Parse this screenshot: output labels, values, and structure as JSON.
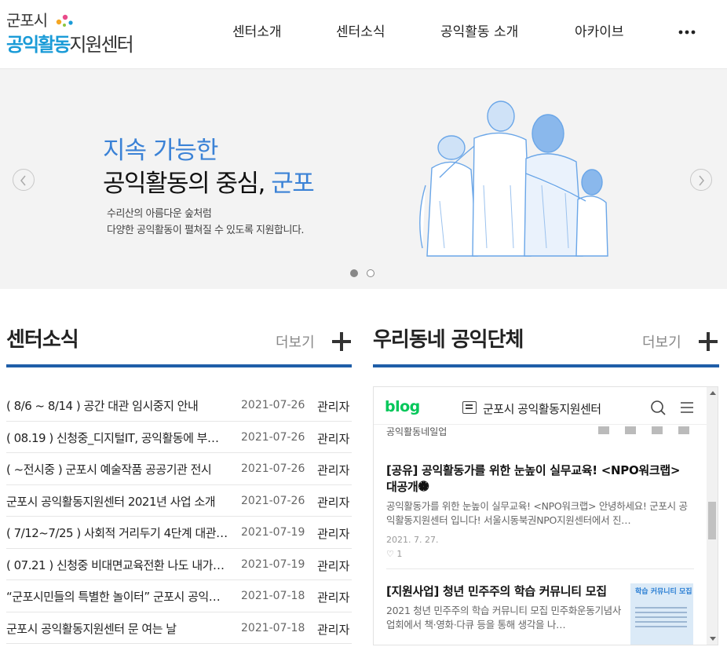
{
  "logo": {
    "line1": "군포시",
    "line2_accent": "공익활동",
    "line2_rest": "지원센터"
  },
  "nav": {
    "items": [
      {
        "label": "센터소개"
      },
      {
        "label": "센터소식"
      },
      {
        "label": "공익활동 소개"
      },
      {
        "label": "아카이브"
      }
    ],
    "more_icon": "more-dots-icon"
  },
  "hero": {
    "headline1": "지속 가능한",
    "headline2": "공익활동의 중심,",
    "headline2_accent": "군포",
    "desc1": "수리산의 아름다운 숲처럼",
    "desc2": "다양한 공익활동이 펼쳐질 수 있도록 지원합니다.",
    "slide_count": 2,
    "active_slide": 1,
    "colors": {
      "accent": "#3b82d6",
      "background": "#f3f3f3"
    }
  },
  "center_news": {
    "title": "센터소식",
    "more_label": "더보기",
    "items": [
      {
        "title": "( 8/6 ~ 8/14 ) 공간 대관 임시중지 안내",
        "date": "2021-07-26",
        "author": "관리자"
      },
      {
        "title": "( 08.19 ) 신청중_디지털IT, 공익활동에 부…",
        "date": "2021-07-26",
        "author": "관리자"
      },
      {
        "title": "( ~전시중 ) 군포시 예술작품 공공기관 전시",
        "date": "2021-07-26",
        "author": "관리자"
      },
      {
        "title": "군포시 공익활동지원센터 2021년 사업 소개",
        "date": "2021-07-26",
        "author": "관리자"
      },
      {
        "title": "( 7/12~7/25 ) 사회적 거리두기 4단계 대관…",
        "date": "2021-07-19",
        "author": "관리자"
      },
      {
        "title": "( 07.21 ) 신청중 비대면교육전환 나도 내가…",
        "date": "2021-07-19",
        "author": "관리자"
      },
      {
        "title": "“군포시민들의 특별한 놀이터” 군포시 공익…",
        "date": "2021-07-18",
        "author": "관리자"
      },
      {
        "title": "군포시 공익활동지원센터 문 여는 날",
        "date": "2021-07-18",
        "author": "관리자"
      }
    ]
  },
  "local_groups": {
    "title": "우리동네 공익단체",
    "more_label": "더보기",
    "blog": {
      "logo": "blog",
      "name": "군포시 공익활동지원센터",
      "category": "공익활동네일업",
      "posts": [
        {
          "title": "[공유] 공익활동가를 위한 눈높이 실무교육! <NPO워크랩> 대공개🏶",
          "body": "공익활동가를 위한 눈높이 실무교육! <NPO워크랩> 안녕하세요! 군포시 공익활동지원센터 입니다! 서울시동북권NPO지원센터에서 진…",
          "date": "2021. 7. 27.",
          "likes": "♡ 1"
        },
        {
          "title": "[지원사업] 청년 민주주의 학습 커뮤니티 모집",
          "body": "2021 청년 민주주의 학습 커뮤니티 모집 민주화운동기념사업회에서 책·영화·다큐 등을 통해 생각을 나…",
          "thumb_label": "학습 커뮤니티 모집"
        }
      ]
    }
  }
}
